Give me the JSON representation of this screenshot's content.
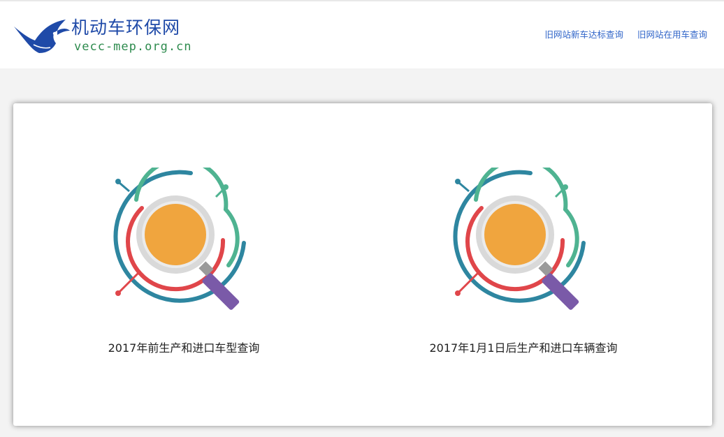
{
  "brand": {
    "name_cn": "机动车环保网",
    "domain": "vecc-mep.org.cn",
    "logo_icon": "bird-icon",
    "color_primary": "#1f4aa8",
    "color_secondary": "#2e8b4e"
  },
  "nav": {
    "links": [
      {
        "label": "旧网站新车达标查询"
      },
      {
        "label": "旧网站在用车查询"
      }
    ],
    "link_color": "#2f64c8"
  },
  "tiles": [
    {
      "label": "2017年前生产和进口车型查询",
      "icon": "magnifier-search-icon"
    },
    {
      "label": "2017年1月1日后生产和进口车辆查询",
      "icon": "magnifier-search-icon"
    }
  ],
  "icon_colors": {
    "outer_ring": "#2e86a0",
    "middle_ring": "#4fb391",
    "inner_ring": "#e0464a",
    "lens": "#f0a53e",
    "handle": "#7a5aa8"
  }
}
